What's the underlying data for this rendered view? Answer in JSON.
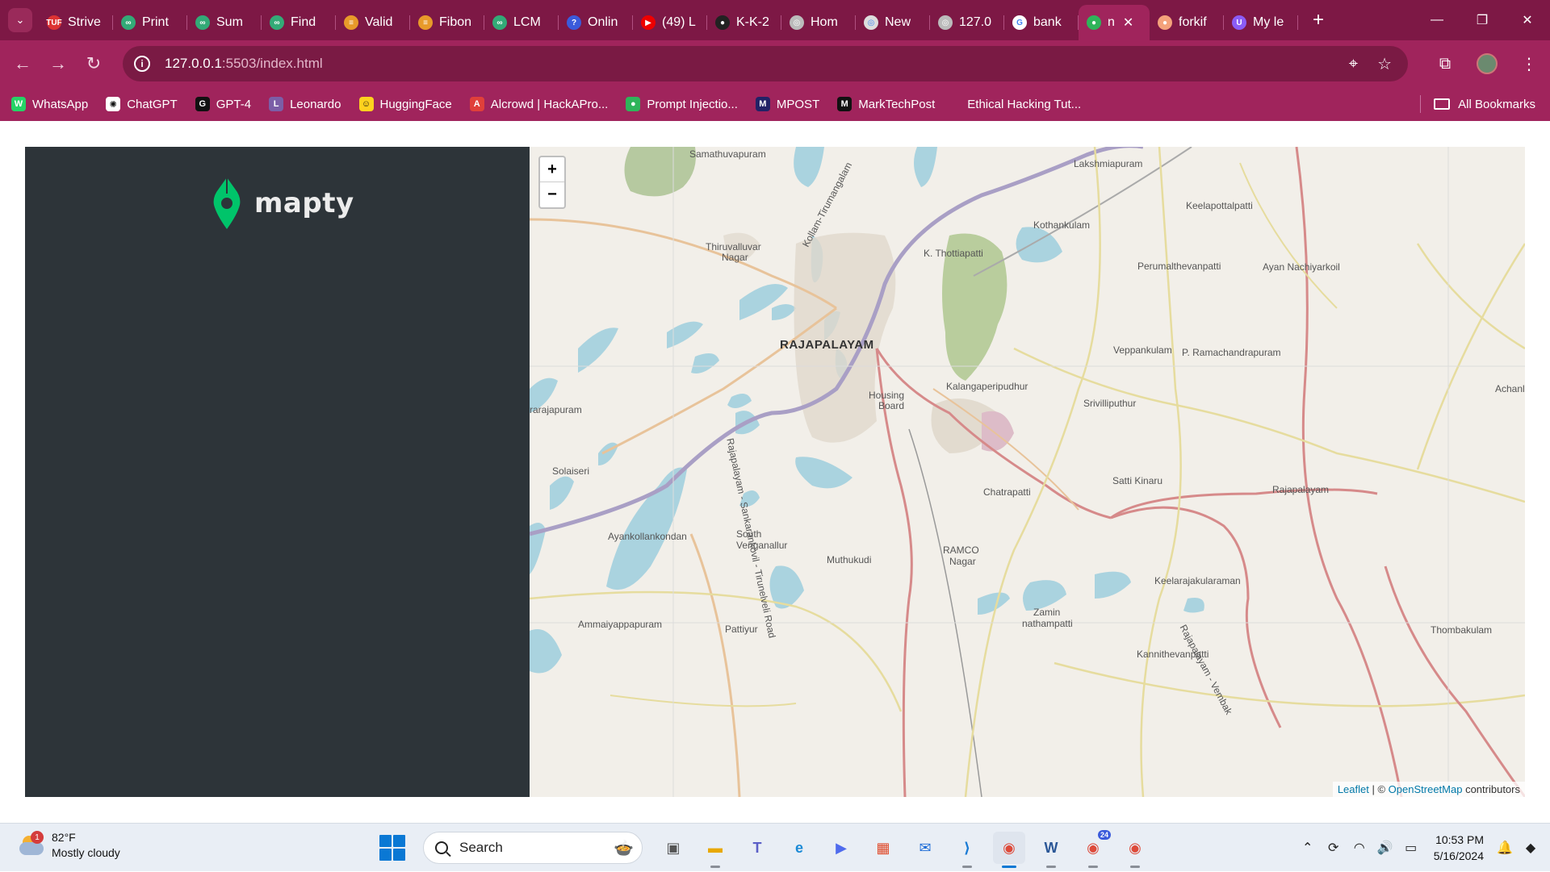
{
  "browser": {
    "tabs": [
      {
        "label": "Strive",
        "fav_color": "#d33",
        "fav_text": "TUF"
      },
      {
        "label": "Print",
        "fav_color": "#3a7",
        "fav_text": "∞"
      },
      {
        "label": "Sum",
        "fav_color": "#3a7",
        "fav_text": "∞"
      },
      {
        "label": "Find",
        "fav_color": "#3a7",
        "fav_text": "∞"
      },
      {
        "label": "Valid",
        "fav_color": "#e89a2a",
        "fav_text": "≡"
      },
      {
        "label": "Fibon",
        "fav_color": "#e89a2a",
        "fav_text": "≡"
      },
      {
        "label": "LCM",
        "fav_color": "#3a7",
        "fav_text": "∞"
      },
      {
        "label": "Onlin",
        "fav_color": "#3b5bdb",
        "fav_text": "?"
      },
      {
        "label": "(49) L",
        "fav_color": "#e00",
        "fav_text": "▶"
      },
      {
        "label": "K-K-2",
        "fav_color": "#222",
        "fav_text": "●"
      },
      {
        "label": "Hom",
        "fav_color": "#bbb",
        "fav_text": "◎"
      },
      {
        "label": "New",
        "fav_color": "#ddd",
        "fav_text": "◎"
      },
      {
        "label": "127.0",
        "fav_color": "#bbb",
        "fav_text": "◎"
      },
      {
        "label": "bank",
        "fav_color": "#fff",
        "fav_text": "G"
      },
      {
        "label": "n",
        "fav_color": "#2fb45a",
        "fav_text": "●",
        "active": true
      },
      {
        "label": "forkif",
        "fav_color": "#f4a27b",
        "fav_text": "●"
      },
      {
        "label": "My le",
        "fav_color": "#8b5cf6",
        "fav_text": "U"
      }
    ],
    "url_host": "127.0.0.1",
    "url_path": ":5503/index.html",
    "bookmarks": [
      {
        "label": "WhatsApp",
        "color": "#25d366",
        "icon": "W"
      },
      {
        "label": "ChatGPT",
        "color": "#ffffff",
        "icon": "✺"
      },
      {
        "label": "GPT-4",
        "color": "#111111",
        "icon": "G"
      },
      {
        "label": "Leonardo",
        "color": "#7b5ea7",
        "icon": "L"
      },
      {
        "label": "HuggingFace",
        "color": "#ffd21e",
        "icon": "☺"
      },
      {
        "label": "Alcrowd | HackAPro...",
        "color": "#e0403a",
        "icon": "A"
      },
      {
        "label": "Prompt Injectio...",
        "color": "#2fb45a",
        "icon": "●"
      },
      {
        "label": "MPOST",
        "color": "#222266",
        "icon": "M"
      },
      {
        "label": "MarkTechPost",
        "color": "#111111",
        "icon": "M"
      },
      {
        "label": "Ethical Hacking Tut...",
        "color": "#a0245c",
        "icon": ""
      }
    ],
    "all_bookmarks": "All Bookmarks"
  },
  "app": {
    "logo_text": "mapty",
    "brand_color": "#00c46a",
    "sidebar_bg": "#2d3439"
  },
  "map": {
    "zoom_in": "+",
    "zoom_out": "−",
    "attribution_leaflet": "Leaflet",
    "attribution_sep": " | © ",
    "attribution_osm": "OpenStreetMap",
    "attribution_suffix": " contributors",
    "labels": [
      {
        "text": "Samathuvapuram"
      },
      {
        "text": "Lakshmiapuram"
      },
      {
        "text": "Keelapottalpatti"
      },
      {
        "text": "Kothankulam"
      },
      {
        "text": "Thiruvalluvar"
      },
      {
        "text": "Nagar"
      },
      {
        "text": "K. Thottiapatti"
      },
      {
        "text": "Perumalthevanpatti"
      },
      {
        "text": "Ayan Nachiyarkoil"
      },
      {
        "text": "RAJAPALAYAM"
      },
      {
        "text": "Veppankulam"
      },
      {
        "text": "P. Ramachandrapuram"
      },
      {
        "text": "Kalangaperipudhur"
      },
      {
        "text": "Housing"
      },
      {
        "text": "Board"
      },
      {
        "text": "Srivilliputhur"
      },
      {
        "text": "Achanl"
      },
      {
        "text": "rarajapuram"
      },
      {
        "text": "Solaiseri"
      },
      {
        "text": "Chatrapatti"
      },
      {
        "text": "Satti Kinaru"
      },
      {
        "text": "Rajapalayam"
      },
      {
        "text": "Ayankollankondan"
      },
      {
        "text": "South"
      },
      {
        "text": "Venganallur"
      },
      {
        "text": "Muthukudi"
      },
      {
        "text": "RAMCO"
      },
      {
        "text": "Nagar"
      },
      {
        "text": "Keelarajakularaman"
      },
      {
        "text": "Zamin"
      },
      {
        "text": "nathampatti"
      },
      {
        "text": "Ammaiyappapuram"
      },
      {
        "text": "Pattiyur"
      },
      {
        "text": "Thombakulam"
      },
      {
        "text": "Kannithevanpatti"
      }
    ],
    "road_labels": [
      {
        "text": "Kollam-Tirumangalam"
      },
      {
        "text": "Rajapalayam - Sankarankovil - Tirunelveli Road"
      },
      {
        "text": "Rajapalayam - Vembak"
      },
      {
        "text": "Rajapalayam"
      },
      {
        "text": "Srivilliputhur"
      }
    ]
  },
  "taskbar": {
    "weather_temp": "82°F",
    "weather_desc": "Mostly cloudy",
    "weather_badge": "1",
    "search_label": "Search",
    "time": "10:53 PM",
    "date": "5/16/2024",
    "chrome_badge": "24"
  }
}
